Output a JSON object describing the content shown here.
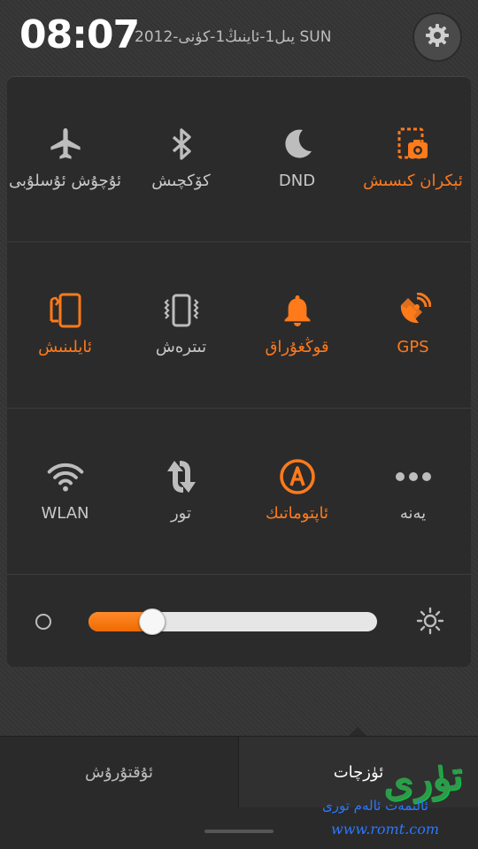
{
  "status": {
    "time": "08:07",
    "date": "2012-يىل1-ئاينىڭ1-كۈنى SUN"
  },
  "colors": {
    "accent": "#ff7a1a",
    "off": "#bdbdbd",
    "panel": "#2b2b2c"
  },
  "toggles": {
    "row1": [
      {
        "label": "ئۇچۇش ئۇسلۇبى",
        "icon": "airplane-icon",
        "on": false
      },
      {
        "label": "كۆكچىش",
        "icon": "bluetooth-icon",
        "on": false
      },
      {
        "label": "DND",
        "icon": "moon-icon",
        "on": false
      },
      {
        "label": "ئېكران كىسىش",
        "icon": "screenshot-icon",
        "on": true
      }
    ],
    "row2": [
      {
        "label": "ئايلىنىش",
        "icon": "rotation-icon",
        "on": true
      },
      {
        "label": "تىترەش",
        "icon": "vibrate-icon",
        "on": false
      },
      {
        "label": "قوڭغۇراق",
        "icon": "bell-icon",
        "on": true
      },
      {
        "label": "GPS",
        "icon": "gps-icon",
        "on": true
      }
    ],
    "row3": [
      {
        "label": "WLAN",
        "icon": "wifi-icon",
        "on": false
      },
      {
        "label": "تور",
        "icon": "data-sync-icon",
        "on": false
      },
      {
        "label": "ئاپتوماتىك",
        "icon": "auto-brightness-icon",
        "on": true
      },
      {
        "label": "يەنە",
        "icon": "more-dots-icon",
        "on": false
      }
    ]
  },
  "brightness": {
    "level": 0.22
  },
  "tabs": {
    "left": "ئۇقتۇرۇش",
    "right": "ئۈزچات"
  },
  "watermark": {
    "art": "تۈرى",
    "line1": "ئالىمەت ئالەم تورى",
    "line2": "www.romt.com"
  }
}
